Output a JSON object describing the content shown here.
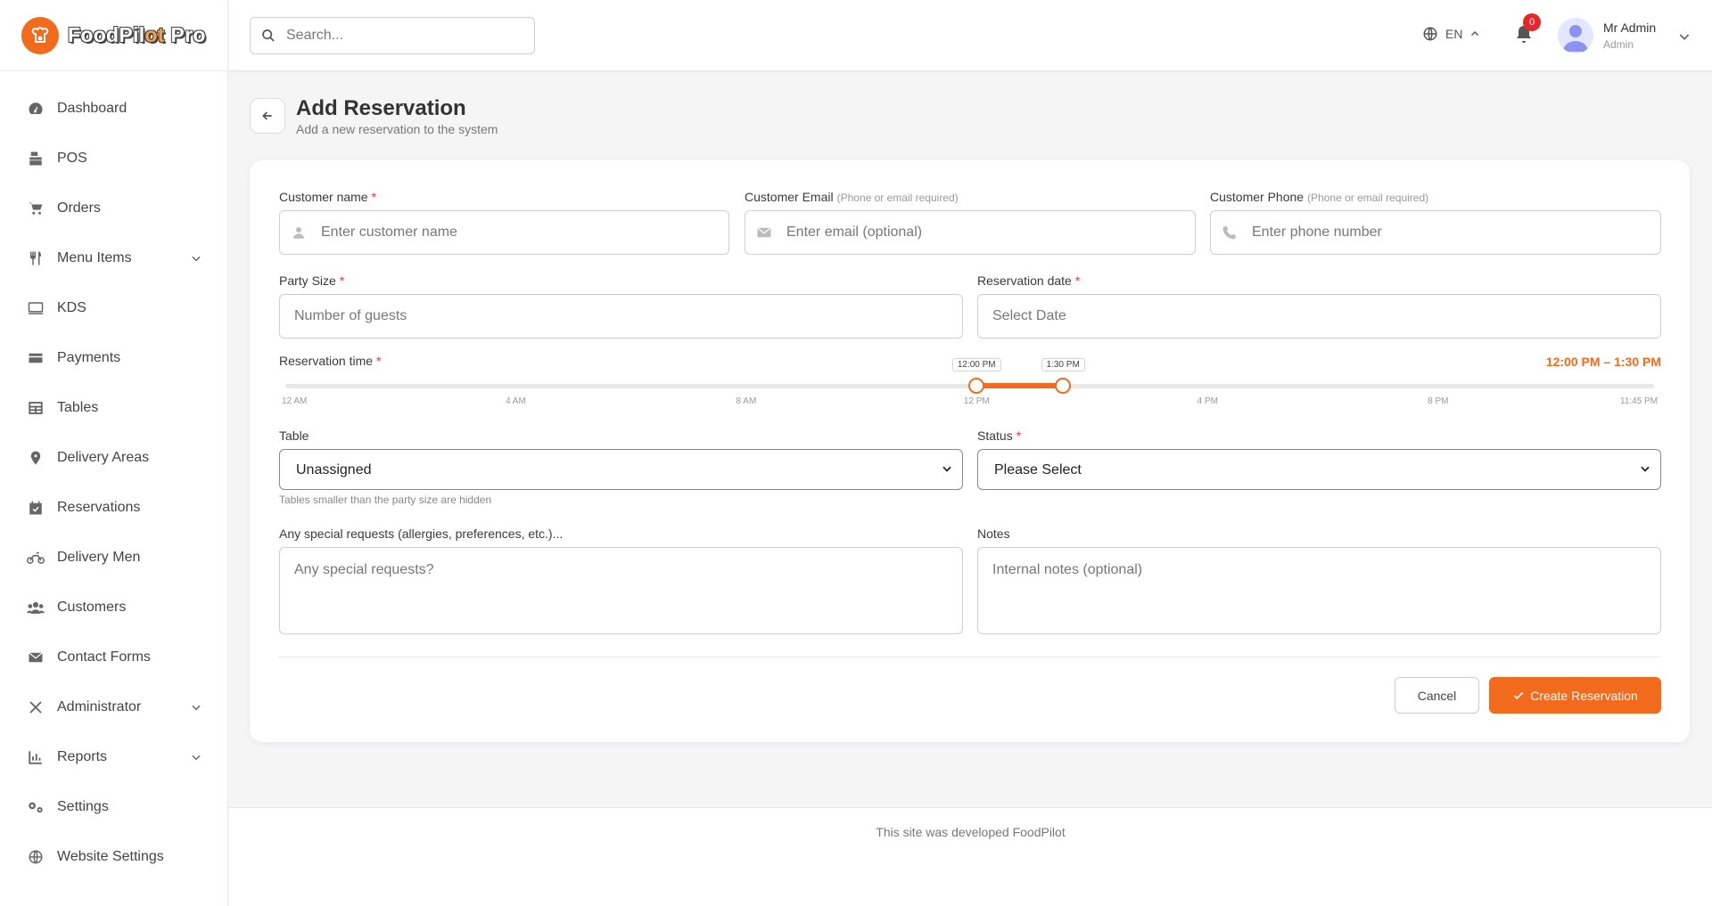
{
  "brand": {
    "name_part1": "FoodPil",
    "name_accent": "ot",
    "name_part2": " Pro",
    "accent_color": "#f26b1d"
  },
  "sidebar": {
    "items": [
      {
        "label": "Dashboard",
        "icon": "dashboard-icon"
      },
      {
        "label": "POS",
        "icon": "pos-icon"
      },
      {
        "label": "Orders",
        "icon": "cart-icon"
      },
      {
        "label": "Menu Items",
        "icon": "utensils-icon",
        "expandable": true
      },
      {
        "label": "KDS",
        "icon": "monitor-icon"
      },
      {
        "label": "Payments",
        "icon": "card-icon"
      },
      {
        "label": "Tables",
        "icon": "table-icon"
      },
      {
        "label": "Delivery Areas",
        "icon": "map-pin-icon"
      },
      {
        "label": "Reservations",
        "icon": "calendar-check-icon"
      },
      {
        "label": "Delivery Men",
        "icon": "motorcycle-icon"
      },
      {
        "label": "Customers",
        "icon": "users-icon"
      },
      {
        "label": "Contact Forms",
        "icon": "envelope-icon"
      },
      {
        "label": "Administrator",
        "icon": "tools-icon",
        "expandable": true
      },
      {
        "label": "Reports",
        "icon": "chart-icon",
        "expandable": true
      },
      {
        "label": "Settings",
        "icon": "gears-icon"
      },
      {
        "label": "Website Settings",
        "icon": "globe-icon"
      }
    ]
  },
  "header": {
    "search_placeholder": "Search...",
    "language": "EN",
    "notification_count": "0",
    "user_name": "Mr Admin",
    "user_role": "Admin"
  },
  "page": {
    "title": "Add Reservation",
    "subtitle": "Add a new reservation to the system"
  },
  "form": {
    "customer_name": {
      "label": "Customer name",
      "required": "*",
      "placeholder": "Enter customer name"
    },
    "customer_email": {
      "label": "Customer Email",
      "hint": "(Phone or email required)",
      "placeholder": "Enter email (optional)"
    },
    "customer_phone": {
      "label": "Customer Phone",
      "hint": "(Phone or email required)",
      "placeholder": "Enter phone number"
    },
    "party_size": {
      "label": "Party Size",
      "required": "*",
      "placeholder": "Number of guests"
    },
    "reservation_date": {
      "label": "Reservation date",
      "required": "*",
      "placeholder": "Select Date"
    },
    "reservation_time": {
      "label": "Reservation time",
      "required": "*",
      "range_text": "12:00 PM – 1:30 PM",
      "start_label": "12:00 PM",
      "end_label": "1:30 PM",
      "start_fraction": 0.5051,
      "end_fraction": 0.5681,
      "ticks": [
        {
          "label": "12 AM",
          "fraction": 0.0
        },
        {
          "label": "4 AM",
          "fraction": 0.1684
        },
        {
          "label": "8 AM",
          "fraction": 0.3368
        },
        {
          "label": "12 PM",
          "fraction": 0.5051
        },
        {
          "label": "4 PM",
          "fraction": 0.6737
        },
        {
          "label": "8 PM",
          "fraction": 0.8421
        },
        {
          "label": "11:45 PM",
          "fraction": 1.0
        }
      ]
    },
    "table": {
      "label": "Table",
      "value": "Unassigned",
      "help": "Tables smaller than the party size are hidden"
    },
    "status": {
      "label": "Status",
      "required": "*",
      "value": "Please Select"
    },
    "special_requests": {
      "label": "Any special requests (allergies, preferences, etc.)...",
      "placeholder": "Any special requests?"
    },
    "notes": {
      "label": "Notes",
      "placeholder": "Internal notes (optional)"
    },
    "cancel_label": "Cancel",
    "submit_label": "Create Reservation"
  },
  "footer": {
    "text": "This site was developed FoodPilot"
  }
}
